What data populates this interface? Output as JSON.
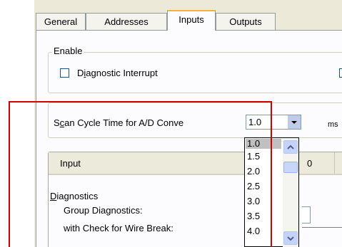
{
  "tabs": [
    {
      "label": "General"
    },
    {
      "label": "Addresses"
    },
    {
      "label": "Inputs",
      "active": true
    },
    {
      "label": "Outputs"
    }
  ],
  "enable_group": {
    "legend": "Enable",
    "diagnostic_interrupt": {
      "prefix": "D",
      "accel": "i",
      "rest": "agnostic Interrupt",
      "checked": false
    }
  },
  "scan_cycle": {
    "label_prefix": "S",
    "label_accel": "c",
    "label_rest": "an Cycle Time for A/D Conve",
    "value": "1.0",
    "unit": "ms"
  },
  "table": {
    "header_input": "Input",
    "header_col2_fragment": "0"
  },
  "rows": {
    "diagnostics": {
      "accel": "D",
      "rest": "iagnostics"
    },
    "group_diagnostics": "Group Diagnostics:",
    "wire_break": "with Check for Wire Break:"
  },
  "dropdown_options": [
    "1.0",
    "1.5",
    "2.0",
    "2.5",
    "3.0",
    "3.5",
    "4.0"
  ],
  "selected_option": "1.0",
  "colors": {
    "highlight_red": "#d20000",
    "dialog_bg": "#ece9d8",
    "active_tab_accent": "#f3b43a"
  }
}
